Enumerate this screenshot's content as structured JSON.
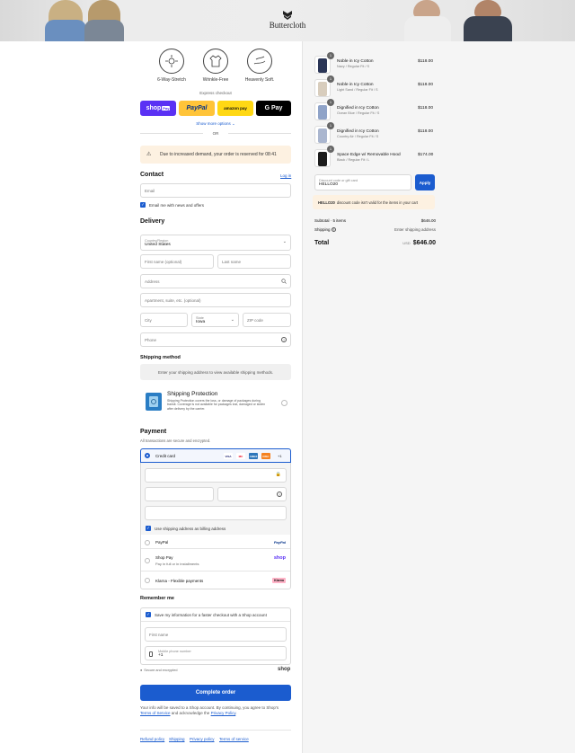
{
  "brand": {
    "name": "Buttercloth"
  },
  "features": [
    {
      "label": "6-Way-Stretch"
    },
    {
      "label": "Wrinkle-Free"
    },
    {
      "label": "Heavenly Soft."
    }
  ],
  "express": {
    "label": "Express checkout",
    "shop_pay": "shop",
    "shop_pay_badge": "Pay",
    "paypal": "PayPal",
    "amazon": "amazon pay",
    "gpay": "G Pay",
    "show_more": "Show more options",
    "or": "OR"
  },
  "notice": {
    "text": "Due to increased demand, your order is reserved for 08:41"
  },
  "contact": {
    "heading": "Contact",
    "login": "Log in",
    "email_placeholder": "Email",
    "newsletter": "Email me with news and offers"
  },
  "delivery": {
    "heading": "Delivery",
    "country_label": "Country/Region",
    "country_value": "United States",
    "first_name": "First name (optional)",
    "last_name": "Last name",
    "address": "Address",
    "apartment": "Apartment, suite, etc. (optional)",
    "city": "City",
    "state_label": "State",
    "state_value": "Iowa",
    "zip": "ZIP code",
    "phone": "Phone"
  },
  "shipping": {
    "heading": "Shipping method",
    "empty": "Enter your shipping address to view available shipping methods."
  },
  "protection": {
    "title": "Shipping Protection",
    "desc": "Shipping Protection covers the loss, or damage of packages during transit. Coverage is not available for packages lost, damaged or stolen after delivery by the carrier."
  },
  "payment": {
    "heading": "Payment",
    "sub": "All transactions are secure and encrypted.",
    "credit": "Credit card",
    "cards": [
      "VISA",
      "MC",
      "AMEX",
      "DISC"
    ],
    "more_cards": "+1",
    "billing": "Use shipping address as billing address",
    "paypal": "PayPal",
    "paypal_logo": "PayPal",
    "shoppay": "Shop Pay",
    "shoppay_sub": "Pay in full or in installments",
    "shoppay_logo": "shop",
    "klarna": "Klarna - Flexible payments",
    "klarna_logo": "Klarna"
  },
  "remember": {
    "heading": "Remember me",
    "save": "Save my information for a faster checkout with a Shop account",
    "first_name": "First name",
    "mobile_label": "Mobile phone number",
    "mobile_value": "+1",
    "secure": "Secure and encrypted",
    "shop_logo": "shop"
  },
  "complete": {
    "label": "Complete order",
    "legal1": "Your info will be saved to a Shop account. By continuing, you agree to Shop's",
    "terms": "Terms of Service",
    "legal2": "and acknowledge the",
    "privacy": "Privacy Policy"
  },
  "footer": {
    "refund": "Refund policy",
    "shipping": "Shipping",
    "privacy": "Privacy policy",
    "terms": "Terms of service"
  },
  "cart": {
    "items": [
      {
        "qty": "1",
        "name": "Noble in Icy Cotton",
        "variant": "Navy / Regular Fit / S",
        "price": "$118.00",
        "color": "#2a3556"
      },
      {
        "qty": "1",
        "name": "Noble in Icy Cotton",
        "variant": "Light Sand / Regular Fit / S",
        "price": "$118.00",
        "color": "#d8cdbd"
      },
      {
        "qty": "1",
        "name": "Dignified in Icy Cotton",
        "variant": "Ocean Blue / Regular Fit / S",
        "price": "$118.00",
        "color": "#8fa3c8"
      },
      {
        "qty": "1",
        "name": "Dignified in Icy Cotton",
        "variant": "Country Air / Regular Fit / S",
        "price": "$118.00",
        "color": "#aab6cf"
      },
      {
        "qty": "1",
        "name": "Space Edge w/ Removable Hood",
        "variant": "Black / Regular Fit / L",
        "price": "$174.00",
        "color": "#1c1c1c"
      }
    ],
    "discount_label": "Discount code or gift card",
    "discount_value": "HELLO20",
    "apply": "Apply",
    "discount_error_code": "HELLO20",
    "discount_error": "discount code isn't valid for the items in your cart",
    "subtotal_label": "Subtotal · 5 items",
    "subtotal": "$646.00",
    "shipping_label": "Shipping",
    "shipping_value": "Enter shipping address",
    "total_label": "Total",
    "currency": "USD",
    "total": "$646.00"
  }
}
